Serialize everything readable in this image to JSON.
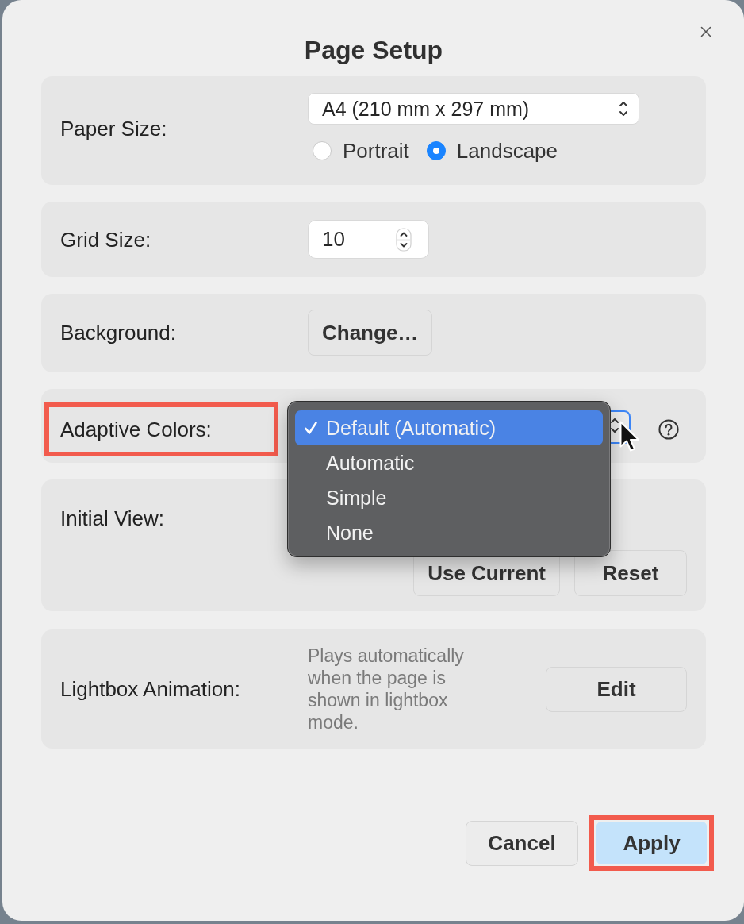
{
  "dialog": {
    "title": "Page Setup"
  },
  "sections": [
    {
      "kind": "popup_radios",
      "label": "Paper Size:",
      "highlighted": false,
      "value": "A4 (210 mm x 297 mm)",
      "options": [
        {
          "label": "Portrait",
          "selected": false
        },
        {
          "label": "Landscape",
          "selected": true
        }
      ]
    },
    {
      "kind": "stepper",
      "label": "Grid Size:",
      "highlighted": false,
      "value": "10"
    },
    {
      "kind": "button",
      "label": "Background:",
      "highlighted": false,
      "buttons": [
        "Change…"
      ]
    },
    {
      "kind": "popup",
      "label": "Adaptive Colors:",
      "highlighted": true,
      "expanded": true,
      "menu": [
        {
          "label": "Default (Automatic)",
          "selected": true
        },
        {
          "label": "Automatic",
          "selected": false
        },
        {
          "label": "Simple",
          "selected": false
        },
        {
          "label": "None",
          "selected": false
        }
      ]
    },
    {
      "kind": "buttons",
      "label": "Initial View:",
      "highlighted": false,
      "buttons": [
        "Use Current",
        "Reset"
      ]
    },
    {
      "kind": "note_button",
      "label": "Lightbox Animation:",
      "highlighted": false,
      "description": "Plays automatically when the page is shown in lightbox mode.",
      "buttons": [
        "Edit"
      ]
    }
  ],
  "footer": {
    "buttons": [
      {
        "label": "Cancel",
        "default": false,
        "highlighted": false
      },
      {
        "label": "Apply",
        "default": true,
        "highlighted": true
      }
    ]
  }
}
